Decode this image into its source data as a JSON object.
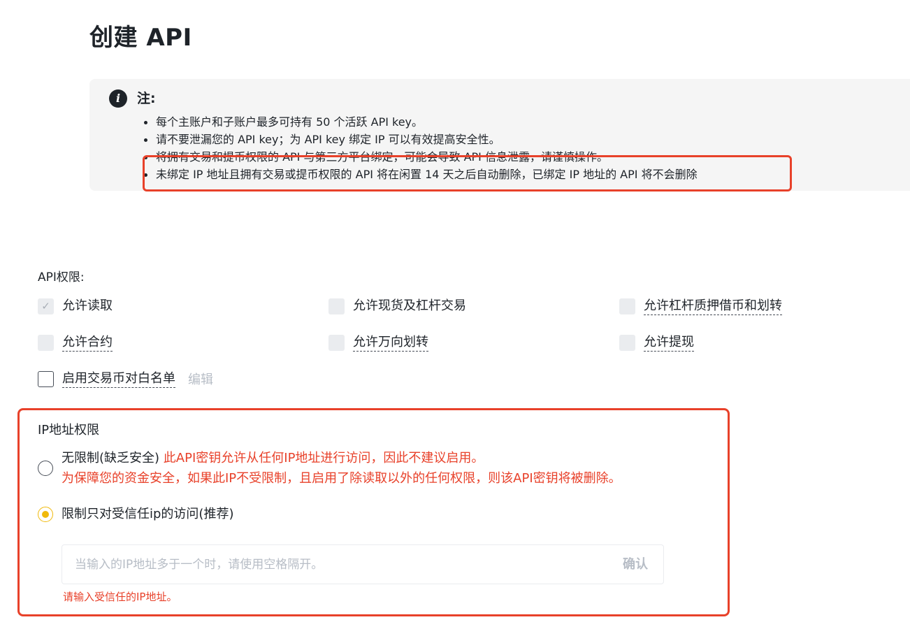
{
  "page": {
    "title": "创建 API"
  },
  "notice": {
    "heading": "注:",
    "items": [
      "每个主账户和子账户最多可持有 50 个活跃 API key。",
      "请不要泄漏您的 API key；为 API key 绑定 IP 可以有效提高安全性。",
      "将拥有交易和提币权限的 API 与第三方平台绑定，可能会导致 API 信息泄露，请谨慎操作。",
      "未绑定 IP 地址且拥有交易或提币权限的 API 将在闲置 14 天之后自动删除，已绑定 IP 地址的 API 将不会删除"
    ]
  },
  "permissions": {
    "title": "API权限:",
    "items": [
      {
        "label": "允许读取",
        "checked": true,
        "disabled": true
      },
      {
        "label": "允许现货及杠杆交易",
        "checked": false,
        "disabled": true
      },
      {
        "label": "允许杠杆质押借币和划转",
        "checked": false,
        "disabled": true
      },
      {
        "label": "允许合约",
        "checked": false,
        "disabled": true
      },
      {
        "label": "允许万向划转",
        "checked": false,
        "disabled": true
      },
      {
        "label": "允许提现",
        "checked": false,
        "disabled": true
      }
    ],
    "whitelist": {
      "label": "启用交易币对白名单",
      "checked": false,
      "edit_label": "编辑"
    }
  },
  "ip_access": {
    "title": "IP地址权限",
    "options": [
      {
        "label": "无限制(缺乏安全)",
        "warning_line1": "此API密钥允许从任何IP地址进行访问，因此不建议启用。",
        "warning_line2": "为保障您的资金安全，如果此IP不受限制，且启用了除读取以外的任何权限，则该API密钥将被删除。",
        "selected": false
      },
      {
        "label": "限制只对受信任ip的访问(推荐)",
        "selected": true
      }
    ],
    "input": {
      "value": "",
      "placeholder": "当输入的IP地址多于一个时，请使用空格隔开。"
    },
    "confirm_label": "确认",
    "error": "请输入受信任的IP地址。"
  },
  "colors": {
    "accent": "#f0b90b",
    "warning": "#e8412a",
    "text": "#1e2329",
    "muted": "#b7bdc6",
    "note_bg": "#f5f5f5"
  }
}
